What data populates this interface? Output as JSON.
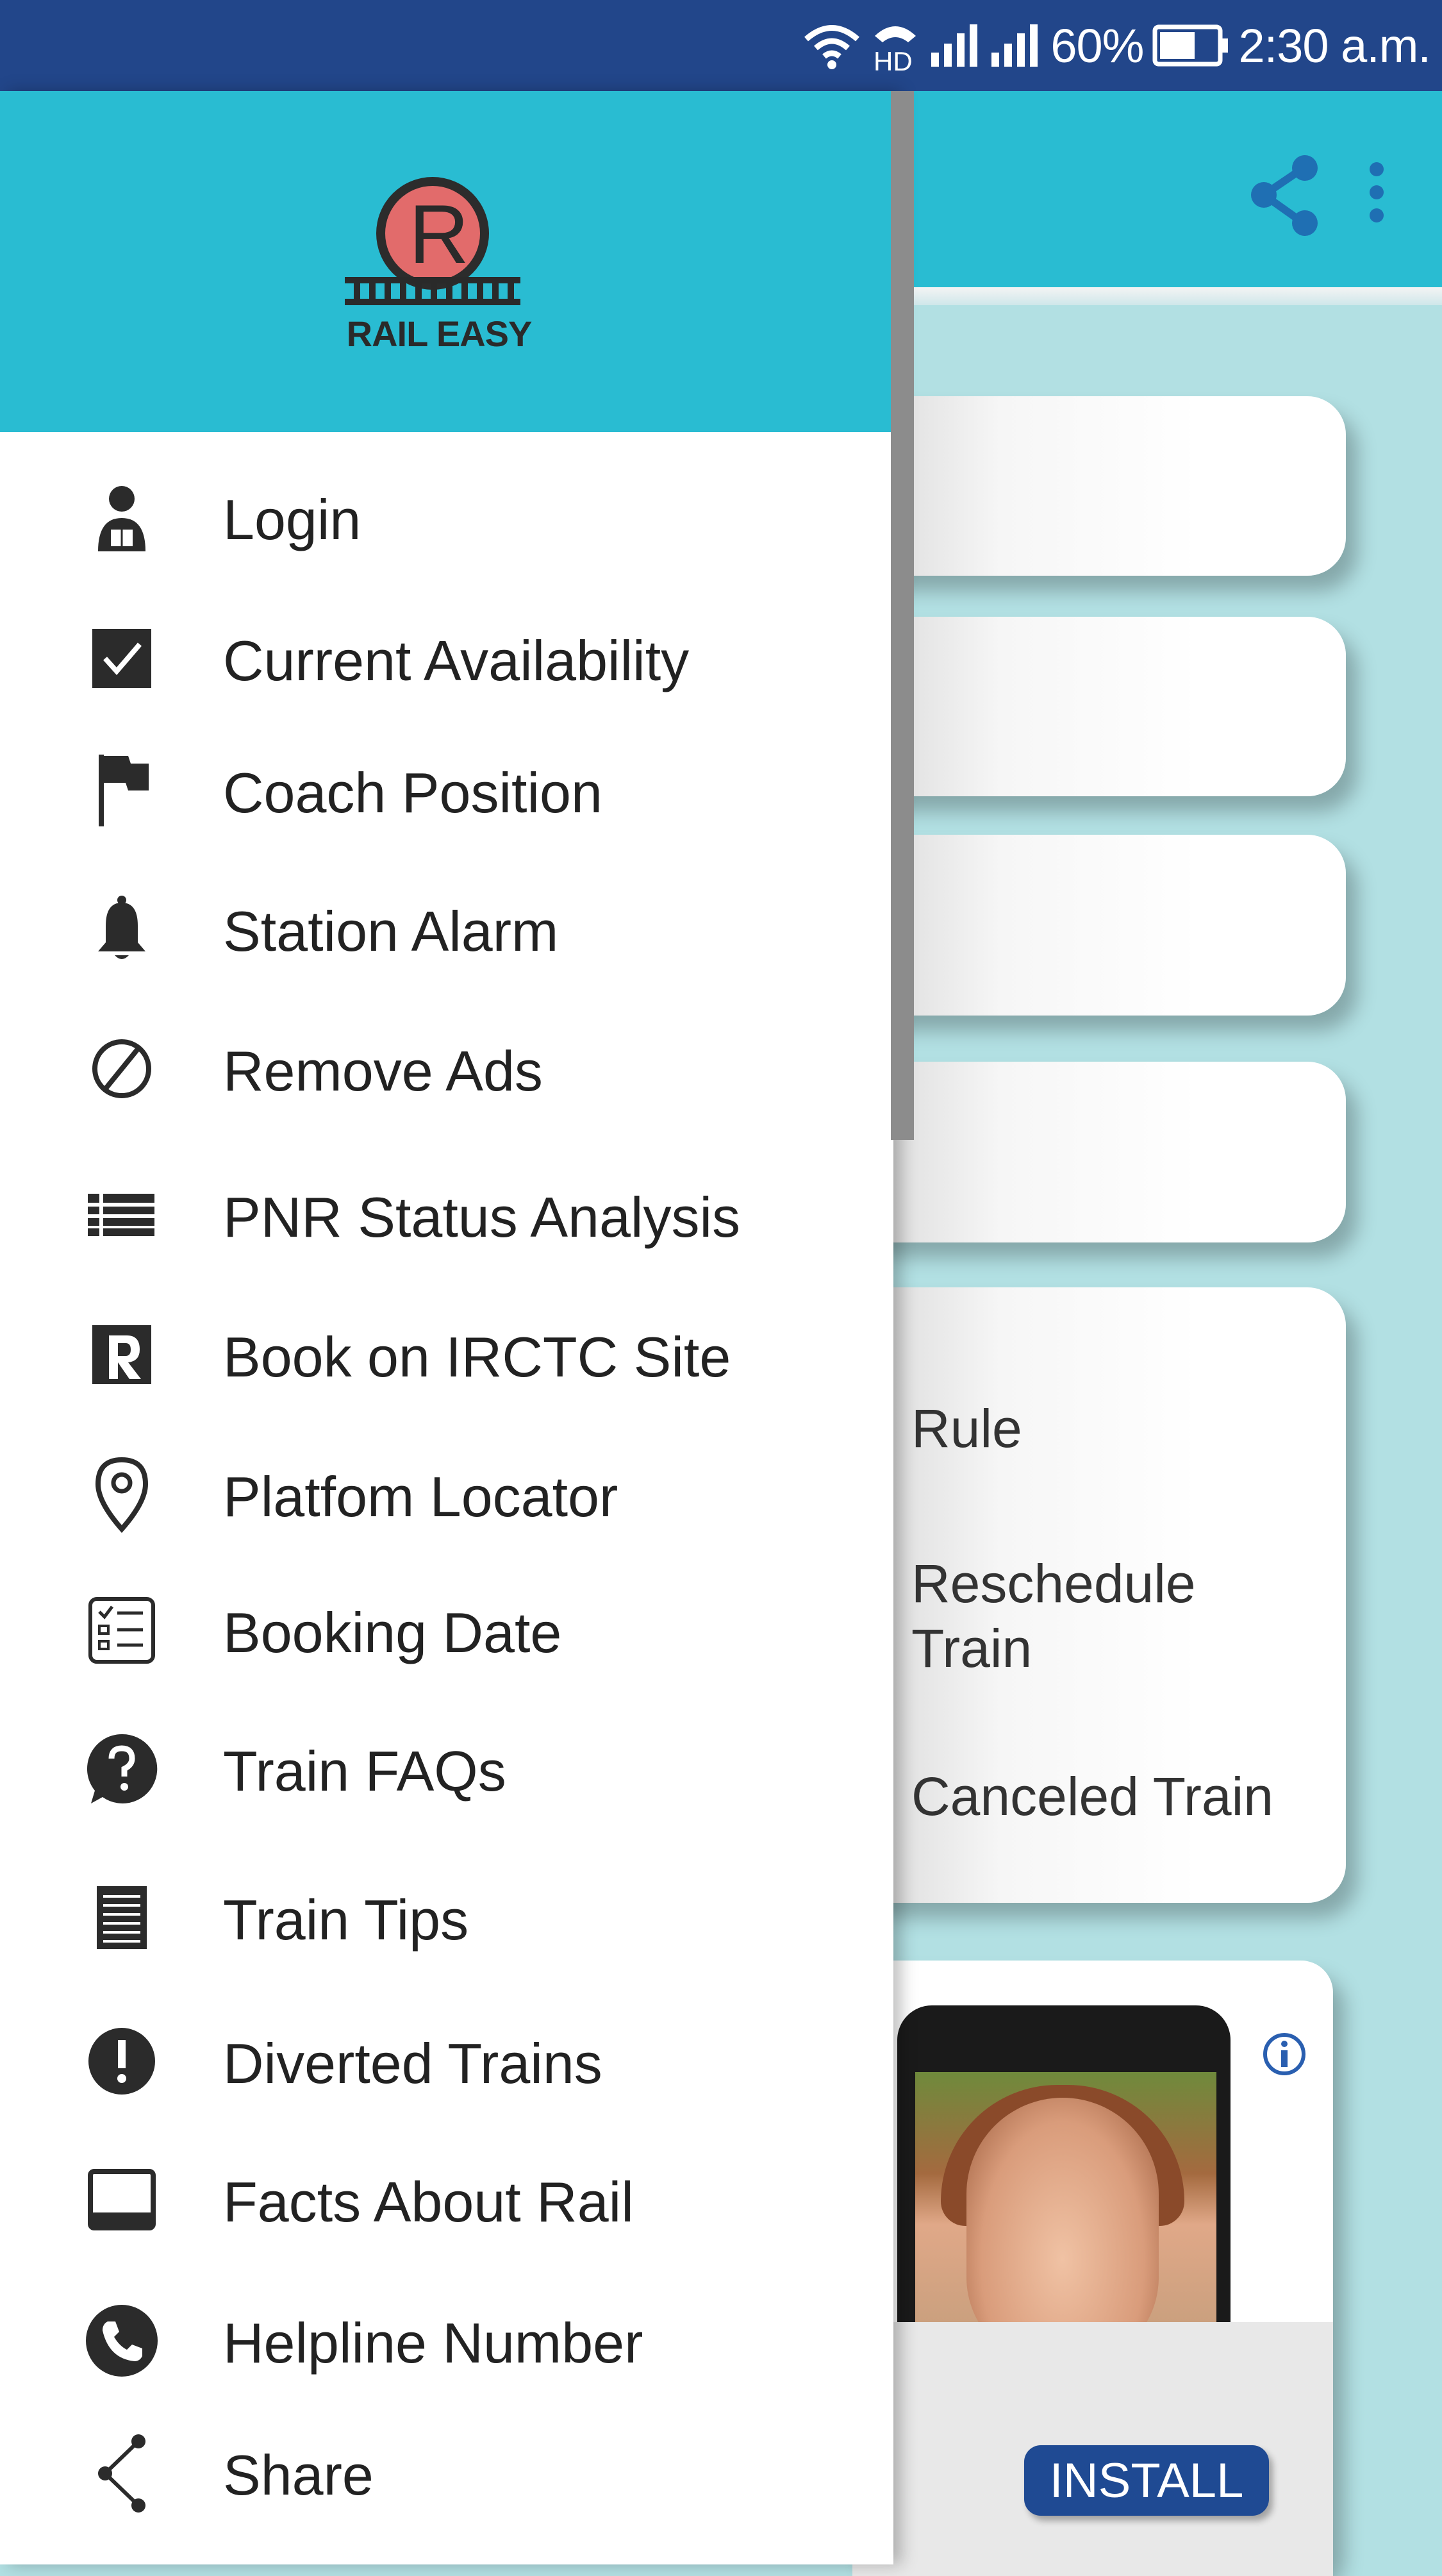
{
  "status_bar": {
    "battery": "60%",
    "time": "2:30 a.m.",
    "network": "HD",
    "icons": [
      "wifi-icon",
      "hd-call-icon",
      "signal-icon",
      "signal-icon",
      "battery-icon"
    ]
  },
  "app": {
    "toolbar_color": "#29bcd2",
    "background_color": "#b2e0e3",
    "card_texts": [
      "Rule",
      "Reschedule Train",
      "Canceled Train"
    ],
    "ad": {
      "install_label": "INSTALL",
      "button_color": "#1f4a93"
    }
  },
  "drawer": {
    "logo_text": "RAIL EASY",
    "header_color": "#29bcd2",
    "items": [
      {
        "label": "Login",
        "icon": "user-icon"
      },
      {
        "label": "Current Availability",
        "icon": "checkbox-icon"
      },
      {
        "label": "Coach Position",
        "icon": "flag-icon"
      },
      {
        "label": "Station Alarm",
        "icon": "bell-icon"
      },
      {
        "label": "Remove Ads",
        "icon": "block-icon"
      },
      {
        "label": "PNR Status Analysis",
        "icon": "list-icon"
      },
      {
        "label": "Book on IRCTC Site",
        "icon": "irctc-icon"
      },
      {
        "label": "Platfom Locator",
        "icon": "location-pin-icon"
      },
      {
        "label": "Booking Date",
        "icon": "checklist-icon"
      },
      {
        "label": "Train FAQs",
        "icon": "help-icon"
      },
      {
        "label": "Train Tips",
        "icon": "notes-icon"
      },
      {
        "label": "Diverted Trains",
        "icon": "alert-icon"
      },
      {
        "label": "Facts About Rail",
        "icon": "tablet-icon"
      },
      {
        "label": "Helpline Number",
        "icon": "phone-icon"
      },
      {
        "label": "Share",
        "icon": "share-icon"
      }
    ]
  }
}
